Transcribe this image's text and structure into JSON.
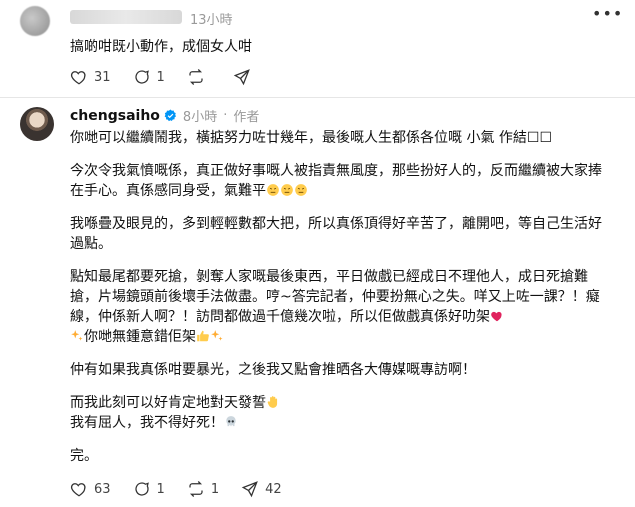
{
  "top_post": {
    "time": "13小時",
    "more": "•••",
    "text": "搞啲咁既小動作，成個女人咁",
    "likes": "31",
    "comments": "1"
  },
  "reply": {
    "username": "chengsaiho",
    "time": "8小時",
    "author_label": "作者",
    "paragraphs": [
      "你哋可以繼續鬧我，橫掂努力咗廿幾年，最後嘅人生都係各位嘅 小氣 作結☐☐",
      "今次令我氣憤嘅係，真正做好事嘅人被指責無風度，那些扮好人的，反而繼續被大家捧在手心。真係感同身受，氣難平",
      "我喺疊及眼見的，多到輕輕數都大把，所以真係頂得好辛苦了，離開吧，等自己生活好過點。",
      "點知最尾都要死搶，剝奪人家嘅最後東西，平日做戲已經成日不理他人，成日死搶難搶，片場鏡頭前後壞手法做盡。哼~答完記者，仲要扮無心之失。咩又上咗一課？！癡線，仲係新人啊？！訪問都做過千億幾次啦，所以佢做戲真係好叻架",
      "你哋無鍾意錯佢架",
      "仲有如果我真係咁要暴光，之後我又點會推晒各大傳媒嘅專訪啊！",
      "而我此刻可以好肯定地對天發誓",
      "我有屈人，我不得好死！",
      "完。"
    ],
    "likes": "63",
    "comments": "1",
    "reposts": "1",
    "shares": "42"
  },
  "colors": {
    "verified": "#0095f6",
    "heart": "#e0245e"
  }
}
